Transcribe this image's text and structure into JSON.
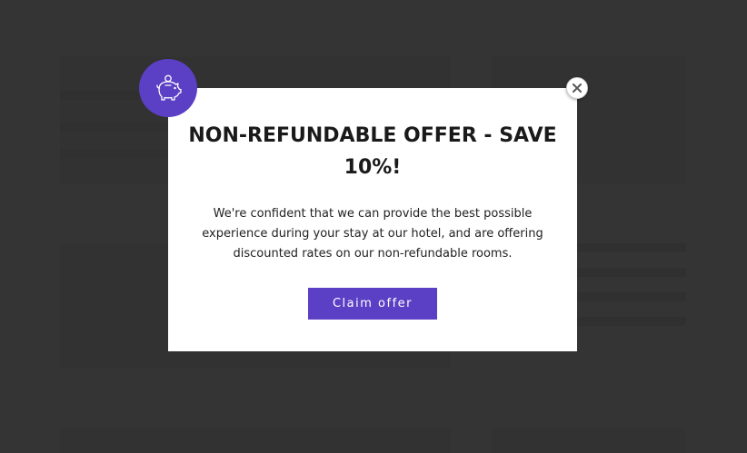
{
  "modal": {
    "title": "NON-REFUNDABLE OFFER - SAVE 10%!",
    "body": "We're confident that we can provide the best possible experience during your stay at our hotel, and are offering discounted rates on our non-refundable rooms.",
    "claim_label": "Claim offer",
    "close_icon": "close-icon",
    "badge_icon": "piggy-bank-icon"
  },
  "colors": {
    "accent": "#5b3fc4",
    "overlay": "#141414",
    "modal_bg": "#ffffff",
    "text": "#1a1a1a"
  }
}
